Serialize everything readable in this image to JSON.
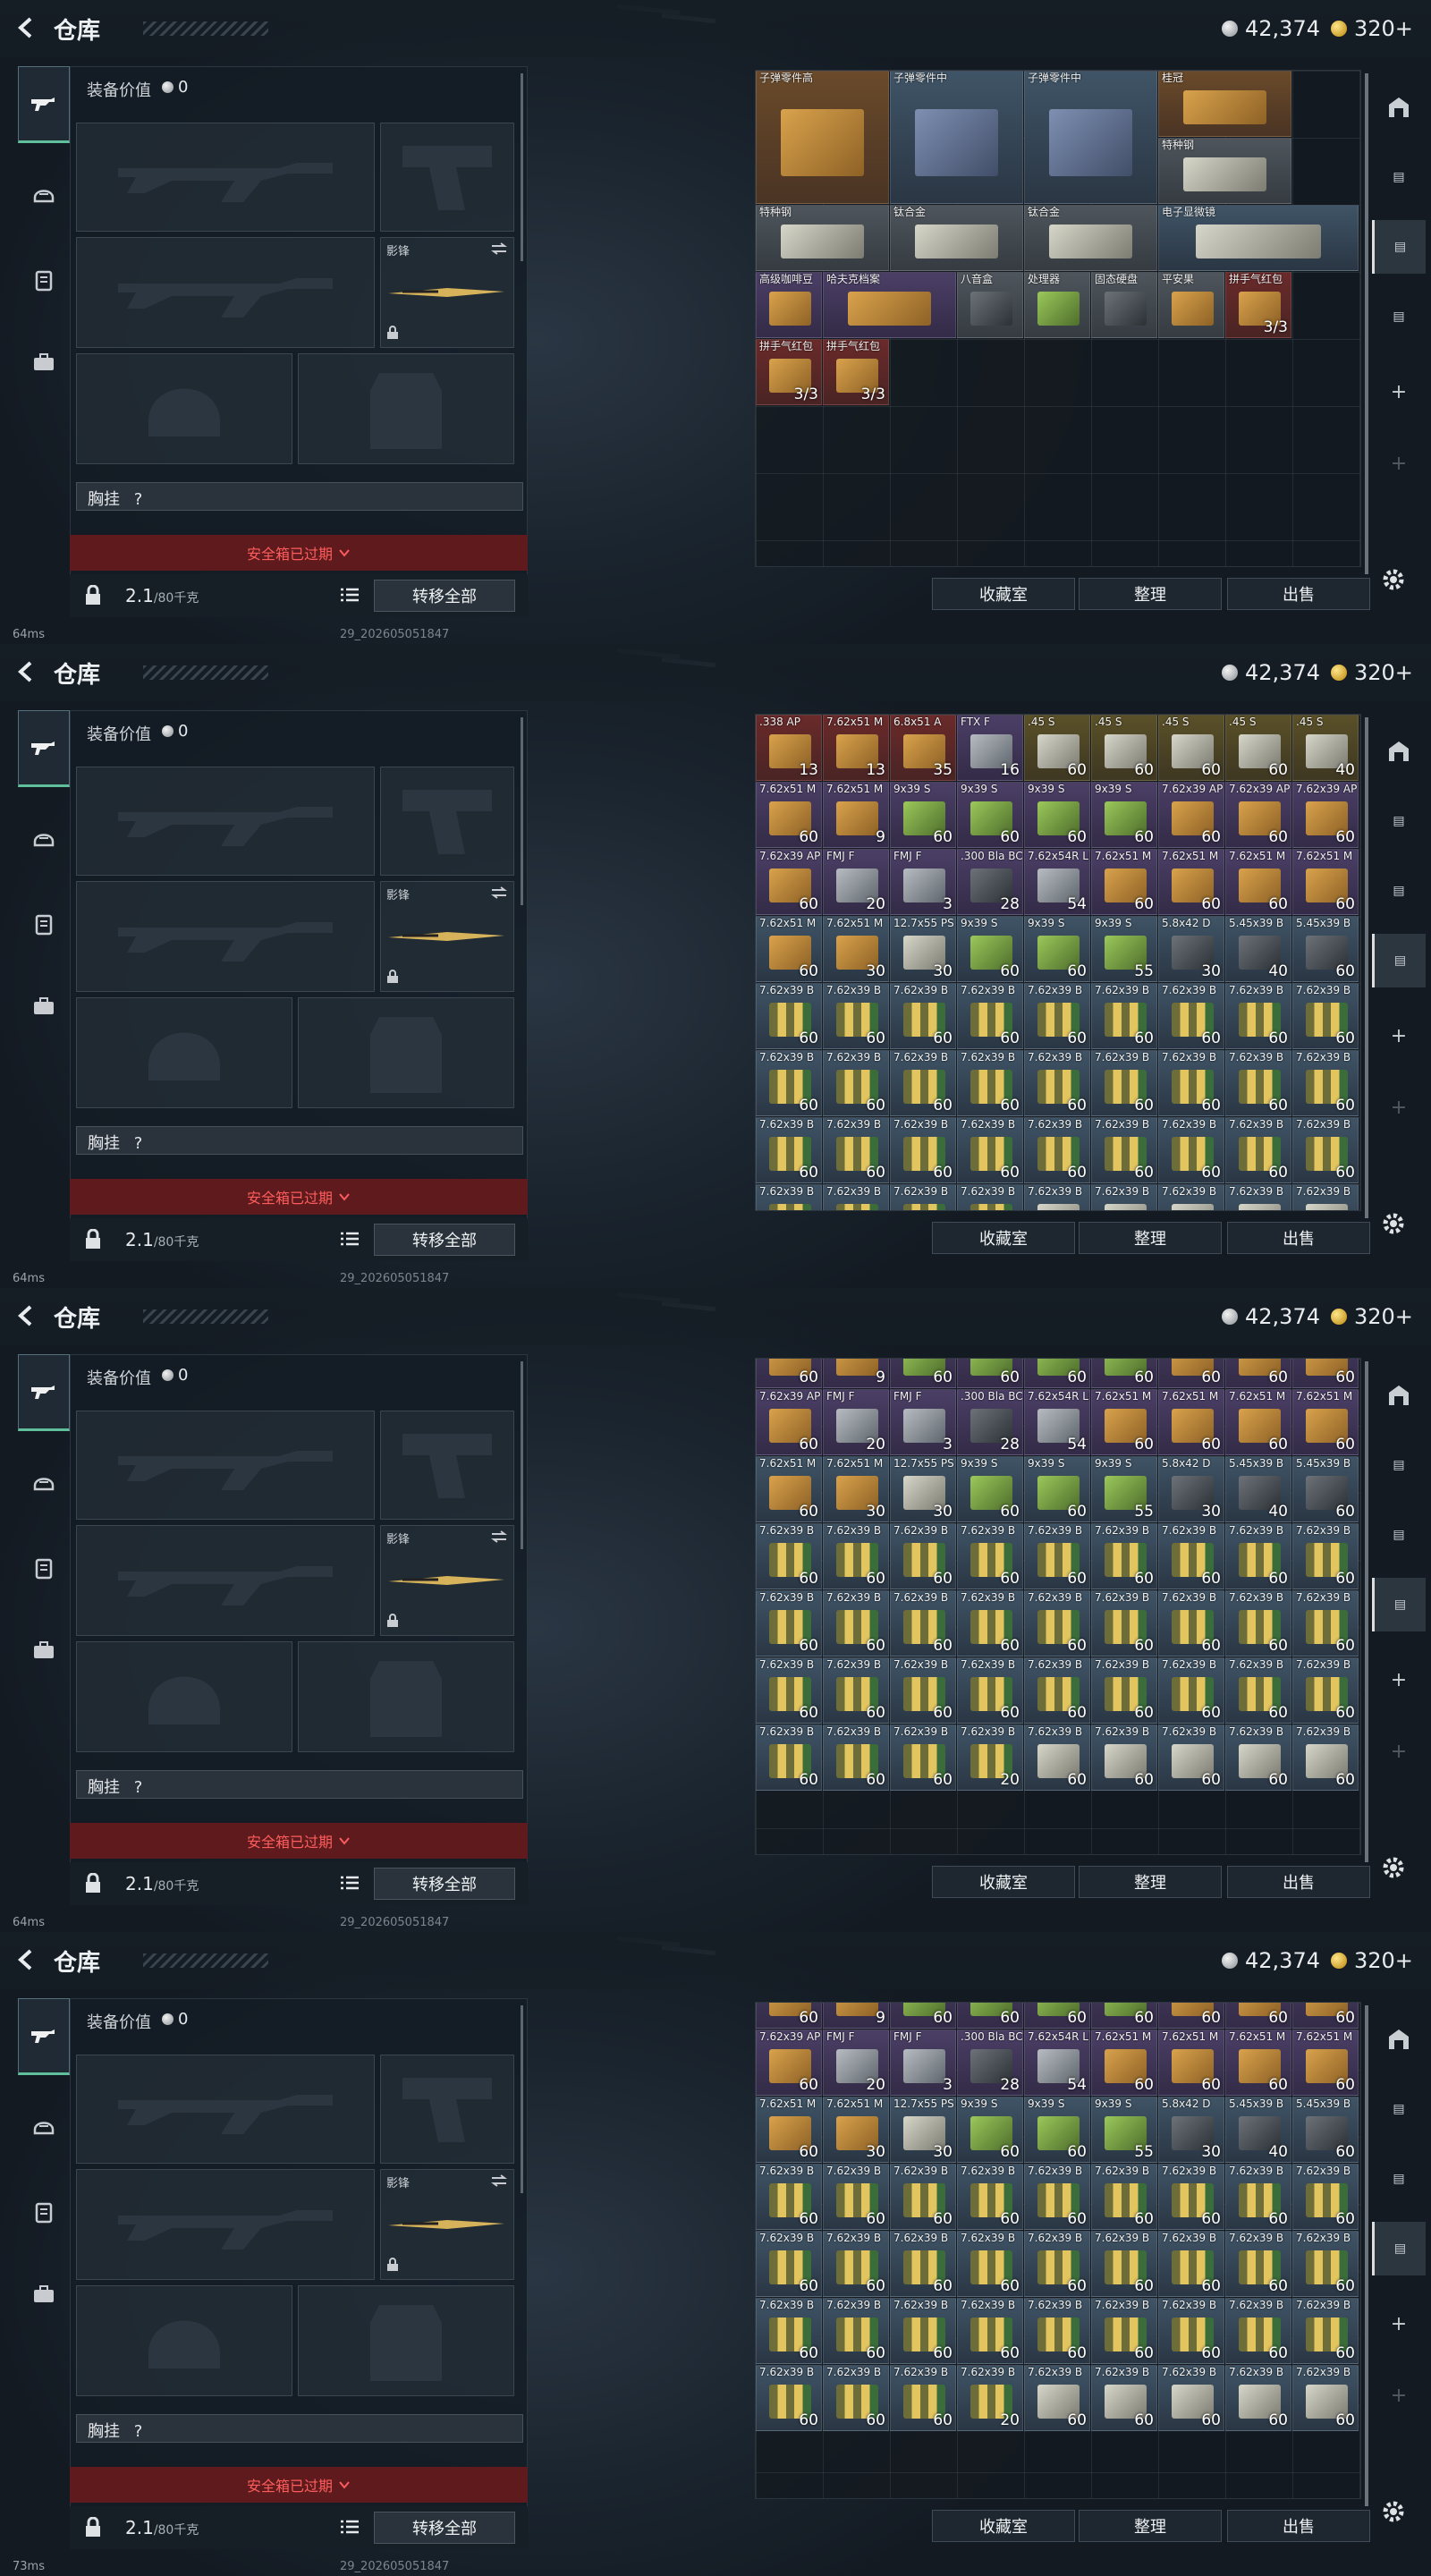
{
  "header": {
    "title": "仓库",
    "silver": "42,374",
    "gold": "320+"
  },
  "equipment": {
    "value_label": "装备价值",
    "value": "0",
    "melee_label": "影锋",
    "chest_label": "胸挂",
    "chest_value": "?",
    "safe_box_status": "安全箱已过期",
    "capacity": "2.1",
    "capacity_max": "/80千克",
    "transfer_all": "转移全部"
  },
  "actions": {
    "collection": "收藏室",
    "sort": "整理",
    "sell": "出售"
  },
  "status": {
    "ping": [
      "64ms",
      "64ms",
      "64ms",
      "73ms"
    ],
    "uid": "29_202605051847"
  },
  "icons": {
    "back": "back-arrow-icon",
    "rifle": "rifle-icon",
    "helmet": "helmet-icon",
    "vest": "vest-icon",
    "briefcase": "briefcase-icon",
    "lock": "lock-icon",
    "swap": "swap-icon",
    "list": "list-icon",
    "settings": "gear-icon",
    "plus": "plus-icon"
  },
  "panels": [
    {
      "rows": [
        [
          {
            "n": "子弹零件高",
            "t": "tint-orange",
            "i": "ammo-box",
            "w": 2,
            "h": 2
          },
          {
            "n": "子弹零件中",
            "t": "tint-blue",
            "i": "ammo-blue",
            "w": 2,
            "h": 2
          },
          {
            "n": "子弹零件中",
            "t": "tint-blue",
            "i": "ammo-blue",
            "w": 2,
            "h": 2
          },
          {
            "n": "桂冠",
            "t": "tint-orange",
            "i": "ammo-box",
            "w": 2,
            "h": 1
          }
        ],
        [
          {
            "n": "特种钢",
            "t": "tint-grey",
            "i": "ammo-silver",
            "w": 2,
            "h": 1
          }
        ],
        [
          {
            "n": "特种钢",
            "t": "tint-grey",
            "i": "ammo-silver",
            "w": 2,
            "h": 1
          },
          {
            "n": "钛合金",
            "t": "tint-grey",
            "i": "ammo-silver",
            "w": 2,
            "h": 1
          },
          {
            "n": "钛合金",
            "t": "tint-grey",
            "i": "ammo-silver",
            "w": 2,
            "h": 1
          },
          {
            "n": "电子显微镜",
            "t": "tint-blue",
            "i": "ammo-silver",
            "w": 3,
            "h": 1
          }
        ],
        [
          {
            "n": "高级咖啡豆",
            "t": "tint-purple",
            "i": "ammo-box",
            "w": 1,
            "h": 1
          },
          {
            "n": "哈夫克档案",
            "t": "tint-purple",
            "i": "ammo-box",
            "w": 2,
            "h": 1
          },
          {
            "n": "八音盒",
            "t": "tint-grey",
            "i": "ammo-dark",
            "w": 1,
            "h": 1
          },
          {
            "n": "处理器",
            "t": "tint-grey",
            "i": "ammo-green",
            "w": 1,
            "h": 1
          },
          {
            "n": "固态硬盘",
            "t": "tint-grey",
            "i": "ammo-dark",
            "w": 1,
            "h": 1
          },
          {
            "n": "平安果",
            "t": "tint-grey",
            "i": "ammo-box",
            "w": 1,
            "h": 1
          },
          {
            "n": "拼手气红包",
            "t": "tint-red",
            "i": "ammo-box",
            "w": 1,
            "h": 1,
            "c": "3/3"
          }
        ],
        [
          {
            "n": "拼手气红包",
            "t": "tint-red",
            "i": "ammo-box",
            "w": 1,
            "h": 1,
            "c": "3/3"
          },
          {
            "n": "拼手气红包",
            "t": "tint-red",
            "i": "ammo-box",
            "w": 1,
            "h": 1,
            "c": "3/3"
          }
        ]
      ]
    },
    {
      "ammo": true,
      "offset": 0,
      "visibleRows": 8
    },
    {
      "ammo": true,
      "offset": 1,
      "visibleRows": 7
    },
    {
      "ammo": true,
      "offset": 1,
      "visibleRows": 7,
      "extraTop": true
    }
  ],
  "ammo_rows": [
    [
      [
        "  .338",
        "AP",
        "13",
        "ammo-box",
        "tint-red"
      ],
      [
        "7.62x51",
        "M",
        "13",
        "ammo-box",
        "tint-red"
      ],
      [
        "6.8x51",
        "A",
        "35",
        "ammo-box",
        "tint-red"
      ],
      [
        "FTX",
        "F",
        "16",
        "ammo-grey",
        "tint-purple"
      ],
      [
        ".45",
        "S",
        "60",
        "ammo-silver",
        "tint-yellow"
      ],
      [
        ".45",
        "S",
        "60",
        "ammo-silver",
        "tint-yellow"
      ],
      [
        ".45",
        "S",
        "60",
        "ammo-silver",
        "tint-yellow"
      ],
      [
        ".45",
        "S",
        "60",
        "ammo-silver",
        "tint-yellow"
      ],
      [
        ".45",
        "S",
        "40",
        "ammo-silver",
        "tint-yellow"
      ]
    ],
    [
      [
        "7.62x51",
        "M",
        "60",
        "ammo-box",
        "tint-purple"
      ],
      [
        "7.62x51",
        "M",
        "9",
        "ammo-box",
        "tint-purple"
      ],
      [
        "9x39",
        "S",
        "60",
        "ammo-green",
        "tint-purple"
      ],
      [
        "9x39",
        "S",
        "60",
        "ammo-green",
        "tint-purple"
      ],
      [
        "9x39",
        "S",
        "60",
        "ammo-green",
        "tint-purple"
      ],
      [
        "9x39",
        "S",
        "60",
        "ammo-green",
        "tint-purple"
      ],
      [
        "7.62x39",
        "AP",
        "60",
        "ammo-box",
        "tint-purple"
      ],
      [
        "7.62x39",
        "AP",
        "60",
        "ammo-box",
        "tint-purple"
      ],
      [
        "7.62x39",
        "AP",
        "60",
        "ammo-box",
        "tint-purple"
      ]
    ],
    [
      [
        "7.62x39",
        "AP",
        "60",
        "ammo-box",
        "tint-purple"
      ],
      [
        "FMJ",
        "F",
        "20",
        "ammo-grey",
        "tint-purple"
      ],
      [
        "FMJ",
        "F",
        "3",
        "ammo-grey",
        "tint-purple"
      ],
      [
        ".300 Bla",
        "BC",
        "28",
        "ammo-dark",
        "tint-purple"
      ],
      [
        "7.62x54R",
        "LP",
        "54",
        "ammo-grey",
        "tint-purple"
      ],
      [
        "7.62x51",
        "M",
        "60",
        "ammo-box",
        "tint-purple"
      ],
      [
        "7.62x51",
        "M",
        "60",
        "ammo-box",
        "tint-purple"
      ],
      [
        "7.62x51",
        "M",
        "60",
        "ammo-box",
        "tint-purple"
      ],
      [
        "7.62x51",
        "M",
        "60",
        "ammo-box",
        "tint-purple"
      ]
    ],
    [
      [
        "7.62x51",
        "M",
        "60",
        "ammo-box",
        "tint-blue"
      ],
      [
        "7.62x51",
        "M",
        "30",
        "ammo-box",
        "tint-blue"
      ],
      [
        "12.7x55",
        "PS",
        "30",
        "ammo-silver",
        "tint-blue"
      ],
      [
        "9x39",
        "S",
        "60",
        "ammo-green",
        "tint-blue"
      ],
      [
        "9x39",
        "S",
        "60",
        "ammo-green",
        "tint-blue"
      ],
      [
        "9x39",
        "S",
        "55",
        "ammo-green",
        "tint-blue"
      ],
      [
        "5.8x42",
        "D",
        "30",
        "ammo-dark",
        "tint-blue"
      ],
      [
        "5.45x39",
        "B",
        "40",
        "ammo-dark",
        "tint-blue"
      ],
      [
        "5.45x39",
        "B",
        "60",
        "ammo-dark",
        "tint-blue"
      ]
    ],
    [
      [
        "7.62x39",
        "B",
        "60",
        "ammo-rounds",
        "tint-blue"
      ],
      [
        "7.62x39",
        "B",
        "60",
        "ammo-rounds",
        "tint-blue"
      ],
      [
        "7.62x39",
        "B",
        "60",
        "ammo-rounds",
        "tint-blue"
      ],
      [
        "7.62x39",
        "B",
        "60",
        "ammo-rounds",
        "tint-blue"
      ],
      [
        "7.62x39",
        "B",
        "60",
        "ammo-rounds",
        "tint-blue"
      ],
      [
        "7.62x39",
        "B",
        "60",
        "ammo-rounds",
        "tint-blue"
      ],
      [
        "7.62x39",
        "B",
        "60",
        "ammo-rounds",
        "tint-blue"
      ],
      [
        "7.62x39",
        "B",
        "60",
        "ammo-rounds",
        "tint-blue"
      ],
      [
        "7.62x39",
        "B",
        "60",
        "ammo-rounds",
        "tint-blue"
      ]
    ],
    [
      [
        "7.62x39",
        "B",
        "60",
        "ammo-rounds",
        "tint-blue"
      ],
      [
        "7.62x39",
        "B",
        "60",
        "ammo-rounds",
        "tint-blue"
      ],
      [
        "7.62x39",
        "B",
        "60",
        "ammo-rounds",
        "tint-blue"
      ],
      [
        "7.62x39",
        "B",
        "60",
        "ammo-rounds",
        "tint-blue"
      ],
      [
        "7.62x39",
        "B",
        "60",
        "ammo-rounds",
        "tint-blue"
      ],
      [
        "7.62x39",
        "B",
        "60",
        "ammo-rounds",
        "tint-blue"
      ],
      [
        "7.62x39",
        "B",
        "60",
        "ammo-rounds",
        "tint-blue"
      ],
      [
        "7.62x39",
        "B",
        "60",
        "ammo-rounds",
        "tint-blue"
      ],
      [
        "7.62x39",
        "B",
        "60",
        "ammo-rounds",
        "tint-blue"
      ]
    ],
    [
      [
        "7.62x39",
        "B",
        "60",
        "ammo-rounds",
        "tint-blue"
      ],
      [
        "7.62x39",
        "B",
        "60",
        "ammo-rounds",
        "tint-blue"
      ],
      [
        "7.62x39",
        "B",
        "60",
        "ammo-rounds",
        "tint-blue"
      ],
      [
        "7.62x39",
        "B",
        "60",
        "ammo-rounds",
        "tint-blue"
      ],
      [
        "7.62x39",
        "B",
        "60",
        "ammo-rounds",
        "tint-blue"
      ],
      [
        "7.62x39",
        "B",
        "60",
        "ammo-rounds",
        "tint-blue"
      ],
      [
        "7.62x39",
        "B",
        "60",
        "ammo-rounds",
        "tint-blue"
      ],
      [
        "7.62x39",
        "B",
        "60",
        "ammo-rounds",
        "tint-blue"
      ],
      [
        "7.62x39",
        "B",
        "60",
        "ammo-rounds",
        "tint-blue"
      ]
    ],
    [
      [
        "7.62x39",
        "B",
        "60",
        "ammo-rounds",
        "tint-blue"
      ],
      [
        "7.62x39",
        "B",
        "60",
        "ammo-rounds",
        "tint-blue"
      ],
      [
        "7.62x39",
        "B",
        "60",
        "ammo-rounds",
        "tint-blue"
      ],
      [
        "7.62x39",
        "B",
        "20",
        "ammo-rounds",
        "tint-blue"
      ],
      [
        "7.62x39",
        "B",
        "60",
        "ammo-silver",
        "tint-blue"
      ],
      [
        "7.62x39",
        "B",
        "60",
        "ammo-silver",
        "tint-blue"
      ],
      [
        "7.62x39",
        "B",
        "60",
        "ammo-silver",
        "tint-blue"
      ],
      [
        "7.62x39",
        "B",
        "60",
        "ammo-silver",
        "tint-blue"
      ],
      [
        "7.62x39",
        "B",
        "60",
        "ammo-silver",
        "tint-blue"
      ]
    ]
  ]
}
